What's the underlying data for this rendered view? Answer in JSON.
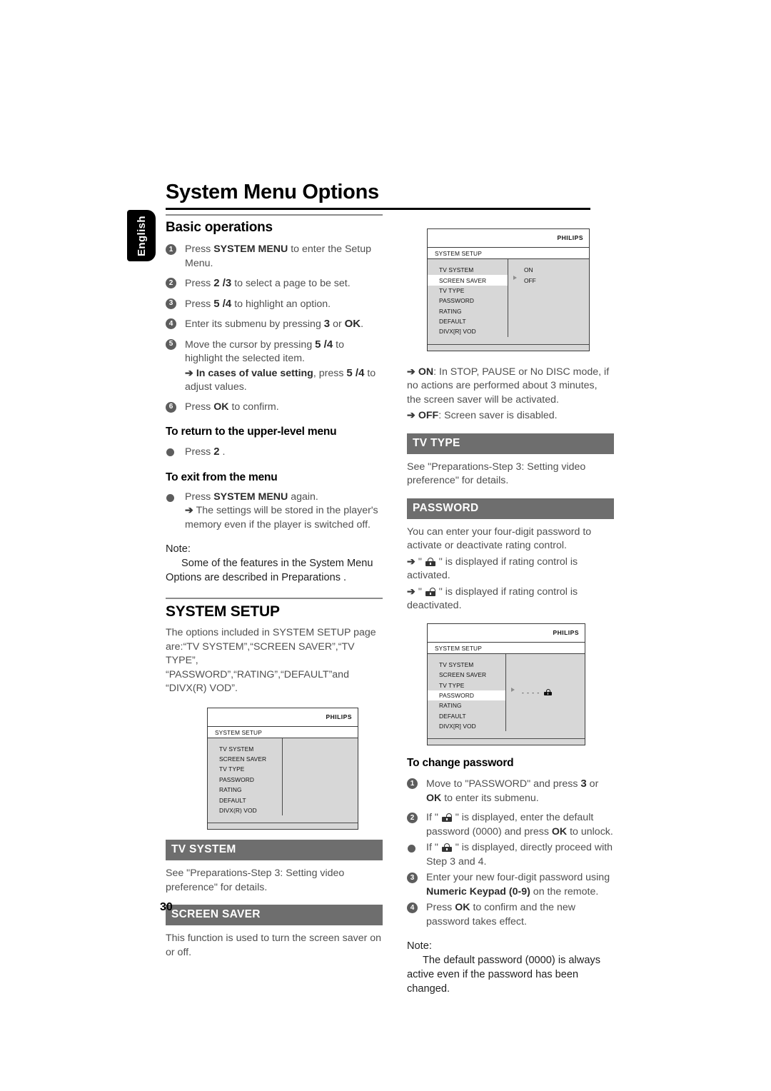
{
  "document": {
    "title": "System Menu Options",
    "language_tab": "English",
    "page_number": "30"
  },
  "left_column": {
    "basic_operations": {
      "heading": "Basic operations",
      "steps": [
        {
          "num": "1",
          "pre": "Press ",
          "bold": "SYSTEM MENU",
          "post": " to enter the Setup Menu."
        },
        {
          "num": "2",
          "pre": "Press ",
          "bold": "2 /3",
          "post": "  to select a page to be set."
        },
        {
          "num": "3",
          "pre": "Press ",
          "bold": "5 /4",
          "post": "  to highlight an option."
        },
        {
          "num": "4",
          "pre": "Enter its submenu by pressing ",
          "bold": "3",
          "post": "  or ",
          "bold2": "OK",
          "post2": "."
        },
        {
          "num": "5",
          "pre": "Move the cursor by pressing ",
          "bold": "5 /4",
          "post": "  to highlight the selected item.",
          "sub_arrow_bold": "In cases of value setting",
          "sub_arrow_mid": ", press ",
          "sub_arrow_bold2": "5 /4",
          "sub_arrow_post": "  to adjust values."
        },
        {
          "num": "6",
          "pre": "Press ",
          "bold": "OK",
          "post": " to confirm."
        }
      ],
      "return_heading": "To return to the upper-level menu",
      "return_bullet_pre": "Press ",
      "return_bullet_bold": "2",
      "return_bullet_post": " .",
      "exit_heading": "To exit from the menu",
      "exit_bullet_pre": "Press ",
      "exit_bullet_bold": "SYSTEM MENU",
      "exit_bullet_post": " again.",
      "exit_arrow": "The settings will be stored in the player's memory even if the player is switched off.",
      "note_label": "Note:",
      "note_text": "Some of the features in the System Menu Options are described in  Preparations ."
    },
    "system_setup": {
      "heading": "SYSTEM SETUP",
      "intro": "The options included in SYSTEM SETUP page are:“TV SYSTEM”,“SCREEN SAVER”,“TV TYPE”, “PASSWORD”,“RATING”,“DEFAULT”and “DIVX(R) VOD”."
    },
    "tv_graphic": {
      "brand": "PHILIPS",
      "screen_title": "SYSTEM SETUP",
      "menu_items": [
        "TV SYSTEM",
        "SCREEN SAVER",
        "TV TYPE",
        "PASSWORD",
        "RATING",
        "DEFAULT",
        "DIVX(R) VOD"
      ],
      "selected": "",
      "side_options": []
    },
    "tv_system": {
      "bar": "TV SYSTEM",
      "text": "See \"Preparations-Step 3: Setting video preference\" for details."
    },
    "screen_saver": {
      "bar": "SCREEN SAVER",
      "text": "This function is used to turn the screen saver on or off."
    }
  },
  "right_column": {
    "tv_graphic_screensaver": {
      "brand": "PHILIPS",
      "screen_title": "SYSTEM SETUP",
      "menu_items": [
        "TV SYSTEM",
        "SCREEN SAVER",
        "TV TYPE",
        "PASSWORD",
        "RATING",
        "DEFAULT",
        "DIVX[R] VOD"
      ],
      "selected": "SCREEN SAVER",
      "side_options": [
        "ON",
        "OFF"
      ]
    },
    "screen_saver_values": {
      "on_label": "ON",
      "on_text": ": In STOP, PAUSE or No DISC mode, if no actions are performed about 3 minutes, the screen saver will be activated.",
      "off_label": "OFF",
      "off_text": ": Screen saver is disabled."
    },
    "tv_type": {
      "bar": "TV TYPE",
      "text": "See \"Preparations-Step 3: Setting video preference\" for details."
    },
    "password": {
      "bar": "PASSWORD",
      "intro": "You can enter your four-digit password to activate or deactivate rating control.",
      "locked_pre": "\" ",
      "locked_post": " \" is displayed if rating control is activated.",
      "unlocked_pre": "\" ",
      "unlocked_post": " \" is displayed if rating control is deactivated."
    },
    "tv_graphic_password": {
      "brand": "PHILIPS",
      "screen_title": "SYSTEM SETUP",
      "menu_items": [
        "TV SYSTEM",
        "SCREEN SAVER",
        "TV TYPE",
        "PASSWORD",
        "RATING",
        "DEFAULT",
        "DIVX[R] VOD"
      ],
      "selected": "PASSWORD",
      "value_dashes": "- - - -"
    },
    "change_password": {
      "heading": "To change password",
      "step1_pre": "Move to \"PASSWORD\" and press ",
      "step1_bold": "3",
      "step1_mid": "  or ",
      "step1_bold2": "OK",
      "step1_post": " to enter its submenu.",
      "step2_pre": "If \" ",
      "step2_mid": " \" is displayed, enter the default password (0000) and press ",
      "step2_bold": "OK",
      "step2_post": " to unlock.",
      "bullet_pre": "If \" ",
      "bullet_post": " \" is displayed, directly proceed with Step 3 and 4.",
      "step3_pre": "Enter your new four-digit password using ",
      "step3_bold": "Numeric Keypad (0-9)",
      "step3_post": " on the remote.",
      "step4_pre": "Press ",
      "step4_bold": "OK",
      "step4_post": " to confirm and the new password takes effect.",
      "note_label": "Note:",
      "note_text": "The default password (0000) is always active even if the password has been changed."
    }
  },
  "colors": {
    "bar_gray": "#6e6e6e",
    "marker_gray": "#5d5d5d",
    "screen_gray": "#d7d7d7",
    "body_text": "#4f4f4f"
  }
}
